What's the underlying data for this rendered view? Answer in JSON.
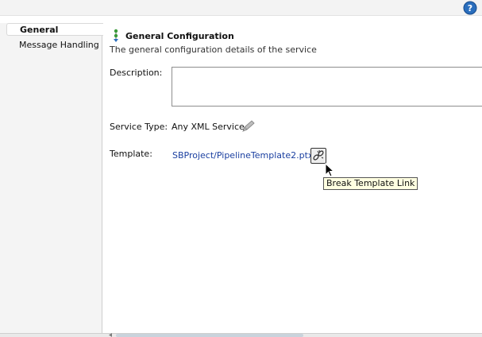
{
  "sidebar": {
    "items": [
      {
        "label": "General",
        "selected": true
      },
      {
        "label": "Message Handling",
        "selected": false
      }
    ]
  },
  "header": {
    "title": "General Configuration",
    "description": "The general configuration details of the service",
    "icon": "config-tree-icon"
  },
  "fields": {
    "description_label": "Description:",
    "description_value": "",
    "service_type_label": "Service Type:",
    "service_type_value": "Any XML Service",
    "template_label": "Template:",
    "template_value": "SBProject/PipelineTemplate2.ptx"
  },
  "tooltip": {
    "text": "Break Template Link"
  },
  "icons": {
    "help": "help-icon",
    "edit": "pencil-icon",
    "break_link": "break-link-icon"
  },
  "colors": {
    "link": "#1a3fa0",
    "help_blue": "#2a6ebd",
    "tooltip_bg": "#ffffe1"
  }
}
